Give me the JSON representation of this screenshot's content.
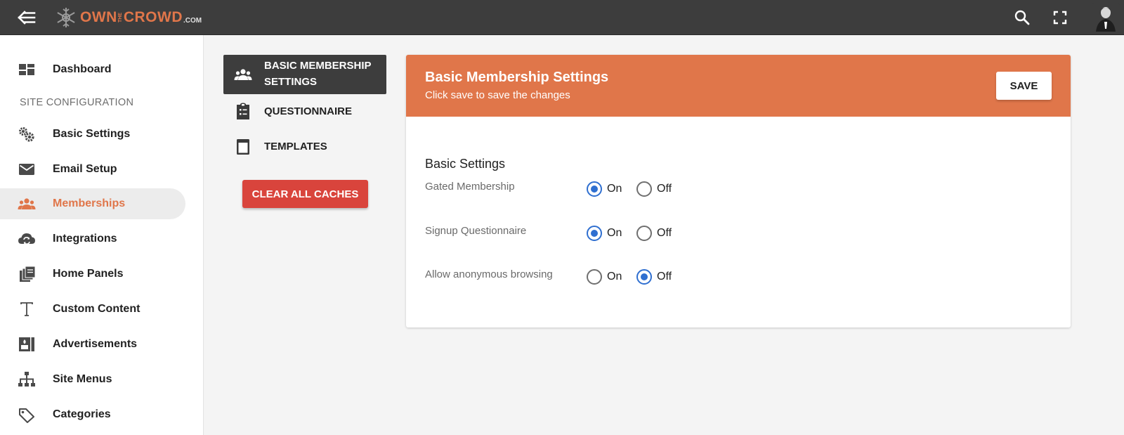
{
  "header": {
    "logo": {
      "own": "OWN",
      "the": "THE",
      "crowd": "CROWD",
      "com": ".COM"
    },
    "icons": [
      "back-menu-icon",
      "search-icon",
      "fullscreen-icon"
    ]
  },
  "sidebar": {
    "section_label": "SITE CONFIGURATION",
    "items": [
      {
        "label": "Dashboard",
        "icon": "dashboard-icon"
      },
      {
        "label": "Basic Settings",
        "icon": "gears-icon"
      },
      {
        "label": "Email Setup",
        "icon": "envelope-icon"
      },
      {
        "label": "Memberships",
        "icon": "people-icon",
        "active": true
      },
      {
        "label": "Integrations",
        "icon": "cloud-sync-icon"
      },
      {
        "label": "Home Panels",
        "icon": "panels-icon"
      },
      {
        "label": "Custom Content",
        "icon": "text-icon"
      },
      {
        "label": "Advertisements",
        "icon": "ad-icon"
      },
      {
        "label": "Site Menus",
        "icon": "sitemap-icon"
      },
      {
        "label": "Categories",
        "icon": "tag-icon"
      }
    ]
  },
  "subnav": {
    "items": [
      {
        "label": "BASIC MEMBERSHIP SETTINGS",
        "icon": "people-icon",
        "active": true
      },
      {
        "label": "QUESTIONNAIRE",
        "icon": "clipboard-list-icon"
      },
      {
        "label": "TEMPLATES",
        "icon": "template-icon"
      }
    ],
    "clear_button": "CLEAR ALL CACHES"
  },
  "card": {
    "title": "Basic Membership Settings",
    "subtitle": "Click save to save the changes",
    "save_label": "SAVE",
    "section_title": "Basic Settings",
    "settings": [
      {
        "label": "Gated Membership",
        "on_label": "On",
        "off_label": "Off",
        "value": "On"
      },
      {
        "label": "Signup Questionnaire",
        "on_label": "On",
        "off_label": "Off",
        "value": "On"
      },
      {
        "label": "Allow anonymous browsing",
        "on_label": "On",
        "off_label": "Off",
        "value": "Off"
      }
    ]
  },
  "colors": {
    "accent": "#e0764a",
    "topbar": "#3d3d3d",
    "radio_checked": "#2f6fd0",
    "clear_button": "#d9443c"
  }
}
